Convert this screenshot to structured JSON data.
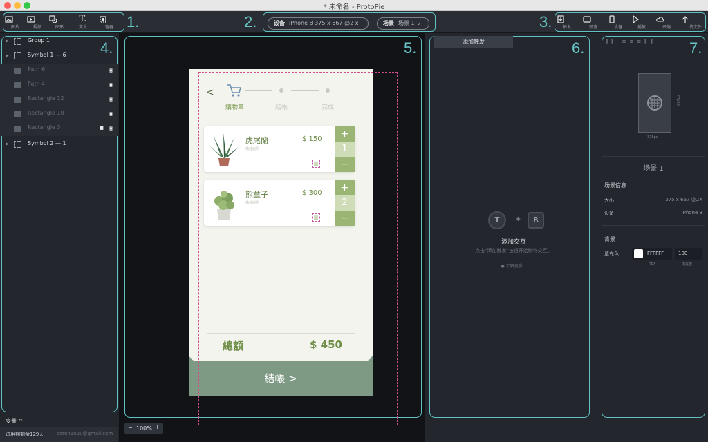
{
  "window": {
    "title": "* 未命名 - ProtoPie"
  },
  "toolbar": {
    "tools": [
      {
        "label": "图片",
        "icon": "image-icon"
      },
      {
        "label": "视频",
        "icon": "video-icon"
      },
      {
        "label": "图形",
        "icon": "shape-icon"
      },
      {
        "label": "文本",
        "icon": "text-icon"
      },
      {
        "label": "容器",
        "icon": "container-icon"
      }
    ],
    "device_key": "设备",
    "device_val": "iPhone 8  375 x 667  @2 x",
    "scene_key": "场景",
    "scene_val": "场景 1",
    "actions": [
      {
        "label": "触发",
        "icon": "trigger-icon"
      },
      {
        "label": "预览",
        "icon": "preview-icon"
      },
      {
        "label": "设备",
        "icon": "device-icon"
      },
      {
        "label": "播放",
        "icon": "play-icon"
      },
      {
        "label": "云端",
        "icon": "cloud-icon"
      },
      {
        "label": "上传文件",
        "icon": "upload-icon"
      }
    ],
    "marks": [
      "1.",
      "2.",
      "3.",
      "4.",
      "5.",
      "6.",
      "7."
    ]
  },
  "layers": [
    {
      "name": "Group 1",
      "type": "group",
      "dim": false
    },
    {
      "name": "Symbol 1 — 6",
      "type": "group",
      "dim": false
    },
    {
      "name": "Path 6",
      "type": "image",
      "dim": true
    },
    {
      "name": "Path 4",
      "type": "image",
      "dim": true
    },
    {
      "name": "Rectangle 12",
      "type": "image",
      "dim": true
    },
    {
      "name": "Rectangle 10",
      "type": "image",
      "dim": true
    },
    {
      "name": "Rectangle 3",
      "type": "image",
      "dim": true,
      "locked": true
    },
    {
      "name": "Symbol 2 — 1",
      "type": "group",
      "dim": false
    }
  ],
  "variables": {
    "label": "变量 ^"
  },
  "footer": {
    "trial": "试用期剩余129天",
    "email": "cat841020@gmail.com"
  },
  "zoom": {
    "minus": "−",
    "value": "100%",
    "plus": "+"
  },
  "phone": {
    "back": "<",
    "steps": [
      "購物車",
      "結帳",
      "完成"
    ],
    "items": [
      {
        "name": "虎尾蘭",
        "sub": "備註說明",
        "price": "$ 150",
        "qty": "1"
      },
      {
        "name": "熊童子",
        "sub": "備註說明",
        "price": "$ 300",
        "qty": "2"
      }
    ],
    "total_label": "總額",
    "total_value": "$ 450",
    "checkout": "結帳 >"
  },
  "interaction": {
    "tab": "添加触发",
    "trigger_key": "T",
    "plus": "+",
    "response_key": "R",
    "title": "添加交互",
    "hint": "点击\"添加触发\"按钮开始制作交互。",
    "learn_more": "了解更多..."
  },
  "properties": {
    "canvas_w": "375px",
    "canvas_h": "667px",
    "scene_name": "场景 1",
    "scene_info": "场景信息",
    "size_key": "大小",
    "size_val": "375 x 667 @2X",
    "device_key": "设备",
    "device_val": "iPhone 8",
    "bg_title": "背景",
    "fill_key": "填充色",
    "hex": "FFFFFF",
    "opacity": "100",
    "hex_label": "HEX",
    "opacity_label": "填充度"
  },
  "colors": {
    "accent": "#5fc3c3",
    "plant_green": "#9bb575",
    "checkout_bg": "#7f9a84"
  }
}
